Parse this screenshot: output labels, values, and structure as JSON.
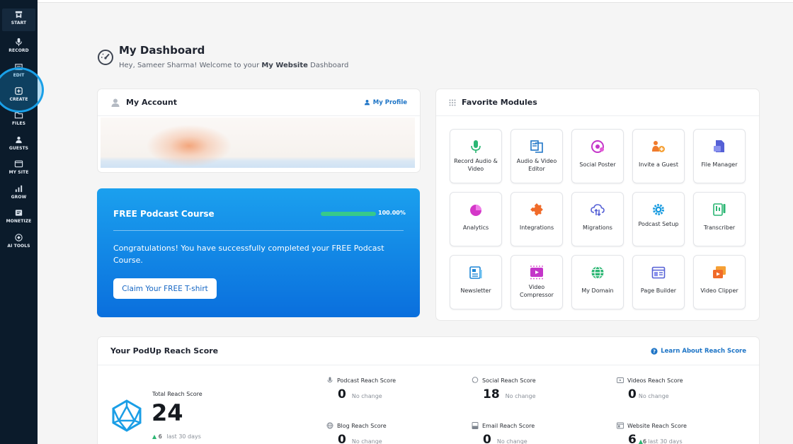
{
  "sidebar": {
    "items": [
      {
        "label": "START",
        "icon": "start-icon"
      },
      {
        "label": "RECORD",
        "icon": "microphone-icon"
      },
      {
        "label": "EDIT",
        "icon": "edit-icon"
      },
      {
        "label": "CREATE",
        "icon": "create-icon"
      },
      {
        "label": "FILES",
        "icon": "folder-icon"
      },
      {
        "label": "GUESTS",
        "icon": "guests-icon"
      },
      {
        "label": "MY SITE",
        "icon": "browser-icon"
      },
      {
        "label": "GROW",
        "icon": "chart-icon"
      },
      {
        "label": "MONETIZE",
        "icon": "monetize-icon"
      },
      {
        "label": "AI TOOLS",
        "icon": "ai-icon"
      }
    ]
  },
  "header": {
    "title": "My Dashboard",
    "subtitle_prefix": "Hey, Sameer Sharma! Welcome to your ",
    "subtitle_bold": "My Website",
    "subtitle_suffix": " Dashboard"
  },
  "account": {
    "title": "My Account",
    "profile_link": "My Profile"
  },
  "course": {
    "title": "FREE Podcast Course",
    "progress": 100,
    "progress_label": "100.00%",
    "message": "Congratulations! You have successfully completed your FREE Podcast Course.",
    "button": "Claim Your FREE T-shirt",
    "bar_color": "#37c98b"
  },
  "modules": {
    "title": "Favorite Modules",
    "items": [
      {
        "label": "Record Audio & Video",
        "icon": "microphone-icon",
        "color": "#2bb673"
      },
      {
        "label": "Audio & Video Editor",
        "icon": "editor-icon",
        "color": "#1d74c6"
      },
      {
        "label": "Social Poster",
        "icon": "social-icon",
        "color": "#c435c9"
      },
      {
        "label": "Invite a Guest",
        "icon": "invite-icon",
        "color": "#f07b2d"
      },
      {
        "label": "File Manager",
        "icon": "file-manager-icon",
        "color": "#5560d6"
      },
      {
        "label": "Analytics",
        "icon": "pie-chart-icon",
        "color": "#d437c8"
      },
      {
        "label": "Integrations",
        "icon": "puzzle-icon",
        "color": "#f06b2a"
      },
      {
        "label": "Migrations",
        "icon": "cloud-sync-icon",
        "color": "#5560d6"
      },
      {
        "label": "Podcast Setup",
        "icon": "gear-icon",
        "color": "#1b9ce0"
      },
      {
        "label": "Transcriber",
        "icon": "transcriber-icon",
        "color": "#2bb673"
      },
      {
        "label": "Newsletter",
        "icon": "newsletter-icon",
        "color": "#1d86d6"
      },
      {
        "label": "Video Compressor",
        "icon": "video-compress-icon",
        "color": "#c435c9"
      },
      {
        "label": "My Domain",
        "icon": "globe-icon",
        "color": "#2bb673"
      },
      {
        "label": "Page Builder",
        "icon": "page-builder-icon",
        "color": "#5560d6"
      },
      {
        "label": "Video Clipper",
        "icon": "video-clipper-icon",
        "color": "#f06b2a"
      }
    ]
  },
  "reach": {
    "title": "Your PodUp Reach Score",
    "learn_link": "Learn About Reach Score",
    "total_label": "Total Reach Score",
    "total_value": "24",
    "total_delta": "6",
    "total_period": "last 30 days",
    "scores": [
      {
        "label": "Podcast Reach Score",
        "value": "0",
        "change": "No change",
        "icon": "microphone-icon"
      },
      {
        "label": "Social Reach Score",
        "value": "18",
        "change": "No change",
        "icon": "chat-icon"
      },
      {
        "label": "Videos Reach Score",
        "value": "0",
        "change": "No change",
        "icon": "video-icon"
      },
      {
        "label": "Blog Reach Score",
        "value": "0",
        "change": "No change",
        "icon": "globe-icon"
      },
      {
        "label": "Email Reach Score",
        "value": "0",
        "change": "No change",
        "icon": "email-icon"
      },
      {
        "label": "Website Reach Score",
        "value": "6",
        "change_delta": "6",
        "change": "last 30 days",
        "icon": "website-icon"
      }
    ]
  },
  "colors": {
    "sidebar_bg": "#0b1b2b",
    "accent": "#1d74c6",
    "positive": "#2bb673"
  }
}
